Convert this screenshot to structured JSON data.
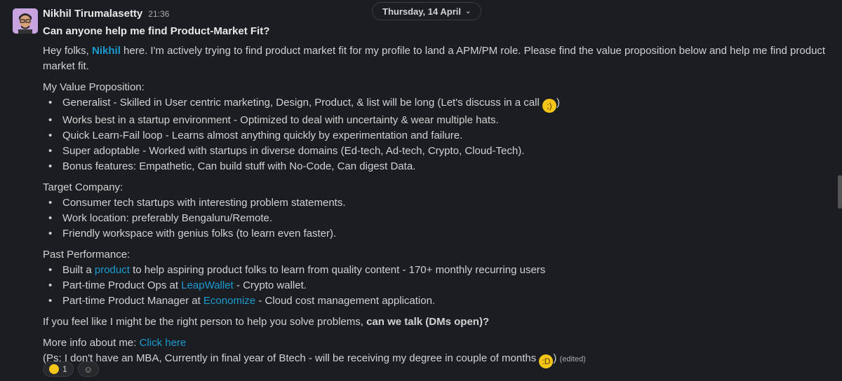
{
  "message": {
    "author": "Nikhil Tirumalasetty",
    "time": "21:36",
    "date_pill": "Thursday, 14 April",
    "title": "Can anyone help me find Product-Market Fit?",
    "intro_pre": "Hey folks, ",
    "intro_mention": "Nikhil",
    "intro_post": " here. I'm actively trying to find product market fit for my profile to land a APM/PM role. Please find the value proposition below and help me find product market fit.",
    "value_label": "My Value Proposition:",
    "value_items": [
      "Generalist - Skilled in User centric marketing, Design, Product, & list will be long (Let's discuss in a call ",
      "Works best in a startup environment - Optimized to deal with uncertainty & wear multiple hats.",
      "Quick Learn-Fail loop - Learns almost anything quickly by experimentation and failure.",
      "Super adoptable - Worked with startups in diverse domains (Ed-tech, Ad-tech, Crypto, Cloud-Tech).",
      " Bonus features: Empathetic, Can build stuff with No-Code, Can digest Data."
    ],
    "value_item0_suffix": ")",
    "target_label": "Target Company:",
    "target_items": [
      "Consumer tech startups with interesting problem statements.",
      "Work location: preferably Bengaluru/Remote.",
      "Friendly workspace with genius folks (to learn even faster)."
    ],
    "past_label": "Past Performance:",
    "past_items": [
      {
        "pre": "Built a ",
        "link": "product",
        "post": " to help aspiring product folks to learn from quality content - 170+ monthly recurring users"
      },
      {
        "pre": "Part-time Product Ops at ",
        "link": "LeapWallet",
        "post": " - Crypto wallet."
      },
      {
        "pre": "Part-time Product Manager at ",
        "link": "Economize",
        "post": " - Cloud cost management application."
      }
    ],
    "closing_pre": "If you feel like I might be the right person to help you solve problems, ",
    "closing_bold": "can we talk (DMs open)?",
    "more_info_pre": "More info about me: ",
    "more_info_link": "Click here",
    "ps_text": "(Ps: I don't have an MBA, Currently in final year of Btech - will be receiving my degree in couple of months ",
    "ps_suffix": ")",
    "edited": "(edited)",
    "reaction_count": "1",
    "emoji_wink": "wink-emoji",
    "emoji_grin": "grin-emoji",
    "reaction_emoji": "star-struck-emoji"
  }
}
